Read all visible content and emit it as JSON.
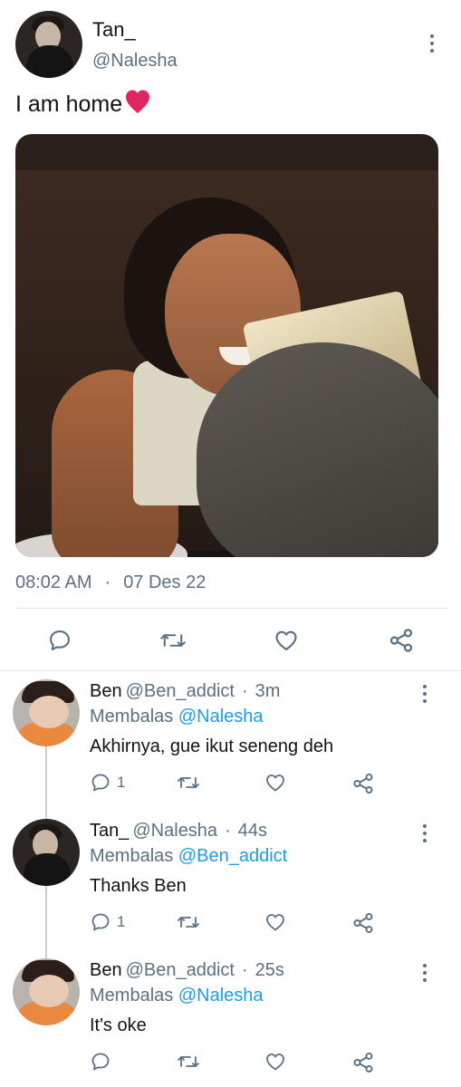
{
  "main_tweet": {
    "author_name": "Tan_",
    "author_handle": "@Nalesha",
    "text": "I am home",
    "emoji": "❤️",
    "time": "08:02 AM",
    "separator": "·",
    "date": "07 Des 22",
    "icons": {
      "reply": "comment-icon",
      "retweet": "retweet-icon",
      "like": "heart-icon",
      "share": "share-icon",
      "more": "more-vertical-icon"
    }
  },
  "replies": [
    {
      "name": "Ben",
      "handle": "@Ben_addict",
      "separator": "·",
      "time": "3m",
      "replying_prefix": "Membalas",
      "replying_to": "@Nalesha",
      "text": "Akhirnya, gue ikut seneng deh",
      "reply_count": "1"
    },
    {
      "name": "Tan_",
      "handle": "@Nalesha",
      "separator": "·",
      "time": "44s",
      "replying_prefix": "Membalas",
      "replying_to": "@Ben_addict",
      "text": "Thanks Ben",
      "reply_count": "1"
    },
    {
      "name": "Ben",
      "handle": "@Ben_addict",
      "separator": "·",
      "time": "25s",
      "replying_prefix": "Membalas",
      "replying_to": "@Nalesha",
      "text": "It's oke",
      "reply_count": ""
    }
  ],
  "colors": {
    "text": "#0f1419",
    "secondary": "#5b7083",
    "link": "#1d9bf0",
    "heart_emoji": "#e0245e"
  }
}
